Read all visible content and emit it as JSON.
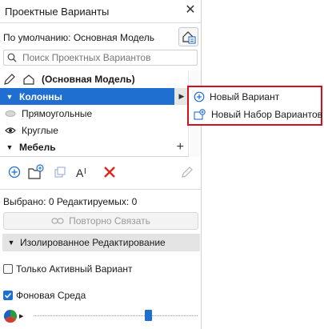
{
  "panel": {
    "title": "Проектные Варианты",
    "default_label": "По умолчанию: Основная Модель",
    "search_placeholder": "Поиск Проектных Вариантов",
    "main_model_label": "(Основная Модель)"
  },
  "tree": [
    {
      "label": "Колонны",
      "type": "set",
      "selected": true,
      "expanded": true
    },
    {
      "label": "Прямоугольные",
      "type": "option",
      "icon": "ellipse-icon"
    },
    {
      "label": "Круглые",
      "type": "option",
      "icon": "eye-icon"
    },
    {
      "label": "Мебель",
      "type": "set",
      "selected": false,
      "expanded": true
    }
  ],
  "status": {
    "text": "Выбрано: 0 Редактируемых: 0",
    "relink_label": "Повторно Связать"
  },
  "isolated_edit": {
    "label": "Изолированное Редактирование",
    "only_active_label": "Только Активный Вариант",
    "only_active_checked": false,
    "background_label": "Фоновая Среда",
    "background_checked": true,
    "slider_value": 0.7
  },
  "popup_menu": {
    "items": [
      {
        "label": "Новый Вариант"
      },
      {
        "label": "Новый Набор Вариантов"
      }
    ]
  },
  "colors": {
    "accent": "#1f6fd0",
    "highlight_border": "#d40f1b",
    "delete_icon": "#e0261b"
  }
}
